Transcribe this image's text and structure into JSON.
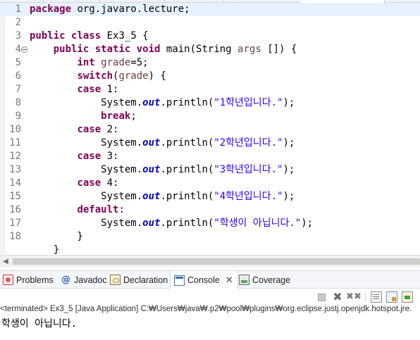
{
  "editor": {
    "lines": [
      {
        "n": "1",
        "tokens": [
          {
            "t": "kw",
            "v": "package"
          },
          {
            "t": "",
            "v": " org.javaro.lecture;"
          }
        ]
      },
      {
        "n": "2",
        "tokens": []
      },
      {
        "n": "3",
        "tokens": [
          {
            "t": "kw",
            "v": "public"
          },
          {
            "t": "",
            "v": " "
          },
          {
            "t": "kw",
            "v": "class"
          },
          {
            "t": "",
            "v": " Ex3_5 {"
          }
        ]
      },
      {
        "n": "4",
        "fold": true,
        "tokens": [
          {
            "t": "",
            "v": "    "
          },
          {
            "t": "kw",
            "v": "public"
          },
          {
            "t": "",
            "v": " "
          },
          {
            "t": "kw",
            "v": "static"
          },
          {
            "t": "",
            "v": " "
          },
          {
            "t": "kw",
            "v": "void"
          },
          {
            "t": "",
            "v": " main(String "
          },
          {
            "t": "var",
            "v": "args"
          },
          {
            "t": "",
            "v": " []) {"
          }
        ]
      },
      {
        "n": "5",
        "tokens": [
          {
            "t": "",
            "v": "        "
          },
          {
            "t": "kw",
            "v": "int"
          },
          {
            "t": "",
            "v": " "
          },
          {
            "t": "var",
            "v": "grade"
          },
          {
            "t": "",
            "v": "=5;"
          }
        ]
      },
      {
        "n": "6",
        "tokens": [
          {
            "t": "",
            "v": "        "
          },
          {
            "t": "kw",
            "v": "switch"
          },
          {
            "t": "",
            "v": "("
          },
          {
            "t": "var",
            "v": "grade"
          },
          {
            "t": "",
            "v": ") {"
          }
        ]
      },
      {
        "n": "7",
        "tokens": [
          {
            "t": "",
            "v": "        "
          },
          {
            "t": "kw",
            "v": "case"
          },
          {
            "t": "",
            "v": " 1:"
          }
        ]
      },
      {
        "n": "8",
        "tokens": [
          {
            "t": "",
            "v": "            System."
          },
          {
            "t": "fld",
            "v": "out"
          },
          {
            "t": "",
            "v": ".println("
          },
          {
            "t": "str",
            "v": "\"1학년입니다.\""
          },
          {
            "t": "",
            "v": ");"
          }
        ]
      },
      {
        "n": "9",
        "tokens": [
          {
            "t": "",
            "v": "            "
          },
          {
            "t": "kw",
            "v": "break"
          },
          {
            "t": "",
            "v": ";"
          }
        ]
      },
      {
        "n": "10",
        "tokens": [
          {
            "t": "",
            "v": "        "
          },
          {
            "t": "kw",
            "v": "case"
          },
          {
            "t": "",
            "v": " 2:"
          }
        ]
      },
      {
        "n": "11",
        "tokens": [
          {
            "t": "",
            "v": "            System."
          },
          {
            "t": "fld",
            "v": "out"
          },
          {
            "t": "",
            "v": ".println("
          },
          {
            "t": "str",
            "v": "\"2학년입니다.\""
          },
          {
            "t": "",
            "v": ");"
          }
        ]
      },
      {
        "n": "12",
        "tokens": [
          {
            "t": "",
            "v": "        "
          },
          {
            "t": "kw",
            "v": "case"
          },
          {
            "t": "",
            "v": " 3:"
          }
        ]
      },
      {
        "n": "13",
        "tokens": [
          {
            "t": "",
            "v": "            System."
          },
          {
            "t": "fld",
            "v": "out"
          },
          {
            "t": "",
            "v": ".println("
          },
          {
            "t": "str",
            "v": "\"3학년입니다.\""
          },
          {
            "t": "",
            "v": ");"
          }
        ]
      },
      {
        "n": "14",
        "tokens": [
          {
            "t": "",
            "v": "        "
          },
          {
            "t": "kw",
            "v": "case"
          },
          {
            "t": "",
            "v": " 4:"
          }
        ]
      },
      {
        "n": "15",
        "tokens": [
          {
            "t": "",
            "v": "            System."
          },
          {
            "t": "fld",
            "v": "out"
          },
          {
            "t": "",
            "v": ".println("
          },
          {
            "t": "str",
            "v": "\"4학년입니다.\""
          },
          {
            "t": "",
            "v": ");"
          }
        ]
      },
      {
        "n": "16",
        "tokens": [
          {
            "t": "",
            "v": "        "
          },
          {
            "t": "kw",
            "v": "default"
          },
          {
            "t": "",
            "v": ":"
          }
        ]
      },
      {
        "n": "17",
        "tokens": [
          {
            "t": "",
            "v": "            System."
          },
          {
            "t": "fld",
            "v": "out"
          },
          {
            "t": "",
            "v": ".println("
          },
          {
            "t": "str",
            "v": "\"학생이 아닙니다.\""
          },
          {
            "t": "",
            "v": ");"
          }
        ]
      },
      {
        "n": "18",
        "tokens": [
          {
            "t": "",
            "v": "        }"
          }
        ]
      },
      {
        "n": "",
        "tokens": [
          {
            "t": "",
            "v": "    }"
          }
        ]
      }
    ]
  },
  "views": {
    "tabs": [
      {
        "id": "problems",
        "label": "Problems",
        "icon": "problems-icon"
      },
      {
        "id": "javadoc",
        "label": "Javadoc",
        "icon": "javadoc-icon",
        "glyph": "@"
      },
      {
        "id": "declaration",
        "label": "Declaration",
        "icon": "declaration-icon"
      },
      {
        "id": "console",
        "label": "Console",
        "icon": "console-icon",
        "active": true,
        "close": "✕"
      },
      {
        "id": "coverage",
        "label": "Coverage",
        "icon": "coverage-icon"
      }
    ]
  },
  "console": {
    "status": "<terminated> Ex3_5 [Java Application] C:₩Users₩java₩.p2₩pool₩plugins₩org.eclipse.justj.openjdk.hotspot.jre.",
    "output": "학생이 아닙니다.",
    "toolbar": {
      "remove": "✖",
      "remove_all": "✖✖"
    }
  }
}
